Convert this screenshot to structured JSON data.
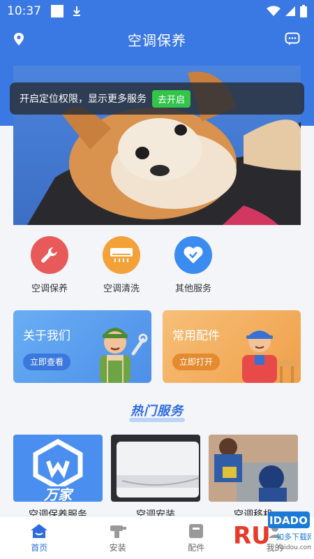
{
  "status_bar": {
    "time": "10:37"
  },
  "header": {
    "title": "空调保养"
  },
  "toast": {
    "text": "开启定位权限，显示更多服务",
    "button": "去开启"
  },
  "services": [
    {
      "label": "空调保养",
      "icon": "wrench-icon",
      "color": "#e85a5a"
    },
    {
      "label": "空调清洗",
      "icon": "air-conditioner-icon",
      "color": "#f3a23a"
    },
    {
      "label": "其他服务",
      "icon": "heart-icon",
      "color": "#3b8cf0"
    }
  ],
  "cards": [
    {
      "title": "关于我们",
      "button": "立即查看"
    },
    {
      "title": "常用配件",
      "button": "立即打开"
    }
  ],
  "hot": {
    "title": "热门服务",
    "items": [
      {
        "label": "空调保养服务"
      },
      {
        "label": "空调安装"
      },
      {
        "label": "空调移机"
      }
    ],
    "first_card_brand": "万家"
  },
  "nav": [
    {
      "label": "首页",
      "icon": "home-icon",
      "active": true
    },
    {
      "label": "安装",
      "icon": "drill-icon",
      "active": false
    },
    {
      "label": "配件",
      "icon": "box-icon",
      "active": false
    },
    {
      "label": "我的",
      "icon": "user-icon",
      "active": false
    }
  ],
  "watermark": {
    "brand": "RUIDADO",
    "sub": "如多下载网",
    "url": "ruidou.com"
  },
  "colors": {
    "primary": "#3a78e3",
    "green": "#33c44a",
    "orange": "#f0a04a"
  }
}
